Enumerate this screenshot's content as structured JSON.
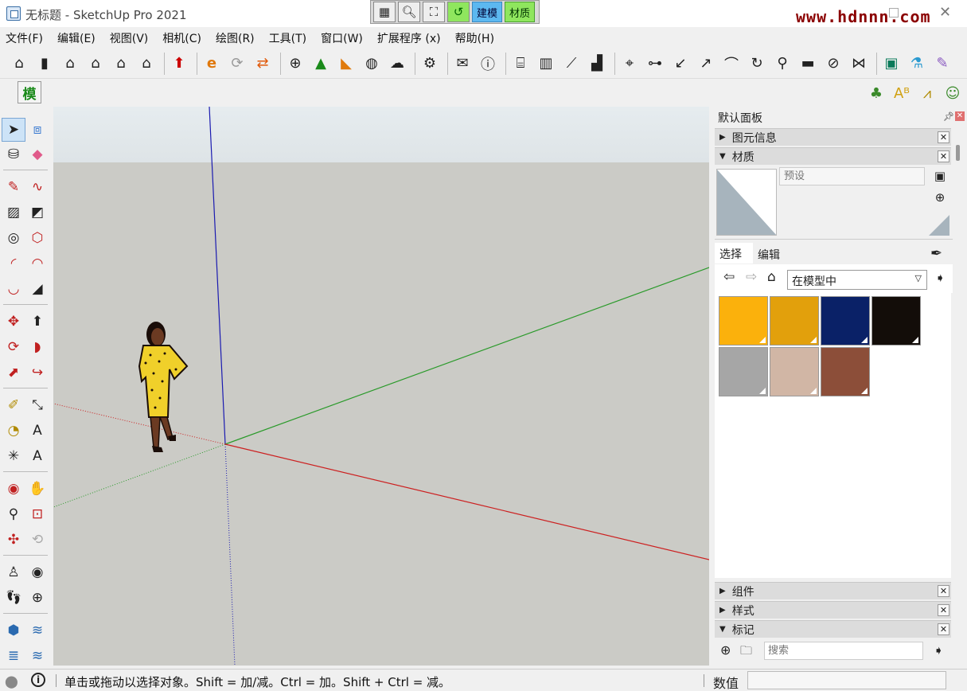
{
  "window": {
    "title": "无标题 - SketchUp Pro 2021",
    "watermark": "www.hdnnn.com"
  },
  "quick_bar": {
    "mode_model": "建模",
    "mode_material": "材质"
  },
  "menu": [
    "文件(F)",
    "编辑(E)",
    "视图(V)",
    "相机(C)",
    "绘图(R)",
    "工具(T)",
    "窗口(W)",
    "扩展程序 (x)",
    "帮助(H)"
  ],
  "toolbar2": {
    "mode_button": "模"
  },
  "tray": {
    "title": "默认面板",
    "sections": {
      "entity_info": "图元信息",
      "materials": "材质",
      "components": "组件",
      "styles": "样式",
      "tags": "标记"
    },
    "materials": {
      "name_placeholder": "预设",
      "tab_select": "选择",
      "tab_edit": "编辑",
      "collection": "在模型中",
      "swatches": [
        "#fbb10c",
        "#e2a00c",
        "#0a2167",
        "#130d09",
        "#a6a6a6",
        "#d1b6a5",
        "#8c4e39"
      ],
      "preview_color": "#a7b4bd"
    },
    "tags": {
      "search_placeholder": "搜索"
    }
  },
  "status": {
    "hint": "单击或拖动以选择对象。Shift = 加/减。Ctrl = 加。Shift + Ctrl = 减。",
    "measurements_label": "数值",
    "measurements_value": ""
  },
  "axes_colors": {
    "red": "#cc2020",
    "green": "#2a9a2a",
    "blue": "#1a1ab0"
  }
}
